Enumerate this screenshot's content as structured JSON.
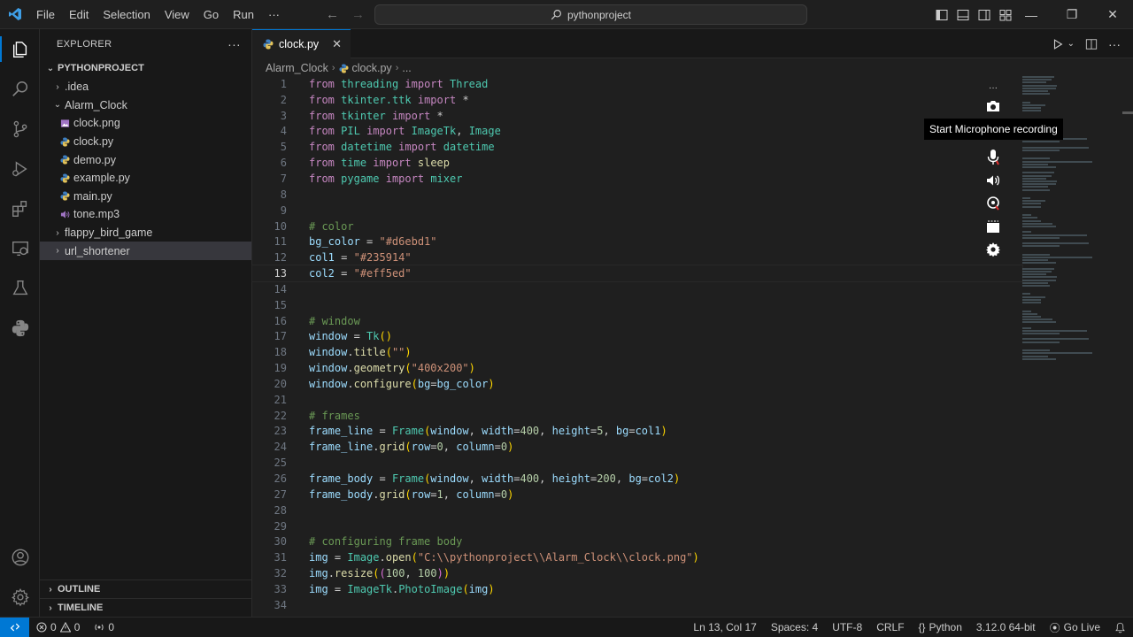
{
  "menu": [
    "File",
    "Edit",
    "Selection",
    "View",
    "Go",
    "Run",
    "···"
  ],
  "search": {
    "text": "pythonproject"
  },
  "window_controls": {
    "minimize": "—",
    "restore": "❐",
    "close": "✕"
  },
  "explorer": {
    "title": "EXPLORER",
    "more": "···",
    "project": "PYTHONPROJECT",
    "items": [
      {
        "label": ".idea",
        "type": "folder-collapsed",
        "depth": 1
      },
      {
        "label": "Alarm_Clock",
        "type": "folder-expanded",
        "depth": 1
      },
      {
        "label": "clock.png",
        "type": "image",
        "depth": 2
      },
      {
        "label": "clock.py",
        "type": "python",
        "depth": 2
      },
      {
        "label": "demo.py",
        "type": "python",
        "depth": 2
      },
      {
        "label": "example.py",
        "type": "python",
        "depth": 2
      },
      {
        "label": "main.py",
        "type": "python",
        "depth": 2
      },
      {
        "label": "tone.mp3",
        "type": "audio",
        "depth": 2
      },
      {
        "label": "flappy_bird_game",
        "type": "folder-collapsed",
        "depth": 1
      },
      {
        "label": "url_shortener",
        "type": "folder-collapsed",
        "depth": 1,
        "selected": true
      }
    ],
    "outline": "OUTLINE",
    "timeline": "TIMELINE"
  },
  "tab": {
    "label": "clock.py",
    "close": "✕"
  },
  "breadcrumbs": {
    "folder": "Alarm_Clock",
    "file": "clock.py",
    "rest": "..."
  },
  "code": [
    [
      [
        "kw",
        "from"
      ],
      [
        "t",
        " "
      ],
      [
        "mod",
        "threading"
      ],
      [
        "t",
        " "
      ],
      [
        "kw",
        "import"
      ],
      [
        "t",
        " "
      ],
      [
        "mod",
        "Thread"
      ]
    ],
    [
      [
        "kw",
        "from"
      ],
      [
        "t",
        " "
      ],
      [
        "mod",
        "tkinter.ttk"
      ],
      [
        "t",
        " "
      ],
      [
        "kw",
        "import"
      ],
      [
        "t",
        " *"
      ]
    ],
    [
      [
        "kw",
        "from"
      ],
      [
        "t",
        " "
      ],
      [
        "mod",
        "tkinter"
      ],
      [
        "t",
        " "
      ],
      [
        "kw",
        "import"
      ],
      [
        "t",
        " *"
      ]
    ],
    [
      [
        "kw",
        "from"
      ],
      [
        "t",
        " "
      ],
      [
        "mod",
        "PIL"
      ],
      [
        "t",
        " "
      ],
      [
        "kw",
        "import"
      ],
      [
        "t",
        " "
      ],
      [
        "mod",
        "ImageTk"
      ],
      [
        "t",
        ", "
      ],
      [
        "mod",
        "Image"
      ]
    ],
    [
      [
        "kw",
        "from"
      ],
      [
        "t",
        " "
      ],
      [
        "mod",
        "datetime"
      ],
      [
        "t",
        " "
      ],
      [
        "kw",
        "import"
      ],
      [
        "t",
        " "
      ],
      [
        "mod",
        "datetime"
      ]
    ],
    [
      [
        "kw",
        "from"
      ],
      [
        "t",
        " "
      ],
      [
        "mod",
        "time"
      ],
      [
        "t",
        " "
      ],
      [
        "kw",
        "import"
      ],
      [
        "t",
        " "
      ],
      [
        "fn",
        "sleep"
      ]
    ],
    [
      [
        "kw",
        "from"
      ],
      [
        "t",
        " "
      ],
      [
        "mod",
        "pygame"
      ],
      [
        "t",
        " "
      ],
      [
        "kw",
        "import"
      ],
      [
        "t",
        " "
      ],
      [
        "mod",
        "mixer"
      ]
    ],
    [],
    [],
    [
      [
        "cmt",
        "# color"
      ]
    ],
    [
      [
        "var",
        "bg_color"
      ],
      [
        "t",
        " = "
      ],
      [
        "str",
        "\"#d6ebd1\""
      ]
    ],
    [
      [
        "var",
        "col1"
      ],
      [
        "t",
        " = "
      ],
      [
        "str",
        "\"#235914\""
      ]
    ],
    [
      [
        "var",
        "col2"
      ],
      [
        "t",
        " = "
      ],
      [
        "str",
        "\"#eff5ed\""
      ]
    ],
    [],
    [],
    [
      [
        "cmt",
        "# window"
      ]
    ],
    [
      [
        "var",
        "window"
      ],
      [
        "t",
        " = "
      ],
      [
        "mod",
        "Tk"
      ],
      [
        "brk",
        "()"
      ]
    ],
    [
      [
        "var",
        "window"
      ],
      [
        "t",
        "."
      ],
      [
        "fn",
        "title"
      ],
      [
        "brk",
        "("
      ],
      [
        "str",
        "\"\""
      ],
      [
        "brk",
        ")"
      ]
    ],
    [
      [
        "var",
        "window"
      ],
      [
        "t",
        "."
      ],
      [
        "fn",
        "geometry"
      ],
      [
        "brk",
        "("
      ],
      [
        "str",
        "\"400x200\""
      ],
      [
        "brk",
        ")"
      ]
    ],
    [
      [
        "var",
        "window"
      ],
      [
        "t",
        "."
      ],
      [
        "fn",
        "configure"
      ],
      [
        "brk",
        "("
      ],
      [
        "var",
        "bg"
      ],
      [
        "t",
        "="
      ],
      [
        "var",
        "bg_color"
      ],
      [
        "brk",
        ")"
      ]
    ],
    [],
    [
      [
        "cmt",
        "# frames"
      ]
    ],
    [
      [
        "var",
        "frame_line"
      ],
      [
        "t",
        " = "
      ],
      [
        "mod",
        "Frame"
      ],
      [
        "brk",
        "("
      ],
      [
        "var",
        "window"
      ],
      [
        "t",
        ", "
      ],
      [
        "var",
        "width"
      ],
      [
        "t",
        "="
      ],
      [
        "num",
        "400"
      ],
      [
        "t",
        ", "
      ],
      [
        "var",
        "height"
      ],
      [
        "t",
        "="
      ],
      [
        "num",
        "5"
      ],
      [
        "t",
        ", "
      ],
      [
        "var",
        "bg"
      ],
      [
        "t",
        "="
      ],
      [
        "var",
        "col1"
      ],
      [
        "brk",
        ")"
      ]
    ],
    [
      [
        "var",
        "frame_line"
      ],
      [
        "t",
        "."
      ],
      [
        "fn",
        "grid"
      ],
      [
        "brk",
        "("
      ],
      [
        "var",
        "row"
      ],
      [
        "t",
        "="
      ],
      [
        "num",
        "0"
      ],
      [
        "t",
        ", "
      ],
      [
        "var",
        "column"
      ],
      [
        "t",
        "="
      ],
      [
        "num",
        "0"
      ],
      [
        "brk",
        ")"
      ]
    ],
    [],
    [
      [
        "var",
        "frame_body"
      ],
      [
        "t",
        " = "
      ],
      [
        "mod",
        "Frame"
      ],
      [
        "brk",
        "("
      ],
      [
        "var",
        "window"
      ],
      [
        "t",
        ", "
      ],
      [
        "var",
        "width"
      ],
      [
        "t",
        "="
      ],
      [
        "num",
        "400"
      ],
      [
        "t",
        ", "
      ],
      [
        "var",
        "height"
      ],
      [
        "t",
        "="
      ],
      [
        "num",
        "200"
      ],
      [
        "t",
        ", "
      ],
      [
        "var",
        "bg"
      ],
      [
        "t",
        "="
      ],
      [
        "var",
        "col2"
      ],
      [
        "brk",
        ")"
      ]
    ],
    [
      [
        "var",
        "frame_body"
      ],
      [
        "t",
        "."
      ],
      [
        "fn",
        "grid"
      ],
      [
        "brk",
        "("
      ],
      [
        "var",
        "row"
      ],
      [
        "t",
        "="
      ],
      [
        "num",
        "1"
      ],
      [
        "t",
        ", "
      ],
      [
        "var",
        "column"
      ],
      [
        "t",
        "="
      ],
      [
        "num",
        "0"
      ],
      [
        "brk",
        ")"
      ]
    ],
    [],
    [],
    [
      [
        "cmt",
        "# configuring frame body"
      ]
    ],
    [
      [
        "var",
        "img"
      ],
      [
        "t",
        " = "
      ],
      [
        "mod",
        "Image"
      ],
      [
        "t",
        "."
      ],
      [
        "fn",
        "open"
      ],
      [
        "brk",
        "("
      ],
      [
        "str",
        "\"C:\\\\pythonproject\\\\Alarm_Clock\\\\clock.png\""
      ],
      [
        "brk",
        ")"
      ]
    ],
    [
      [
        "var",
        "img"
      ],
      [
        "t",
        "."
      ],
      [
        "fn",
        "resize"
      ],
      [
        "brk",
        "("
      ],
      [
        "brk2",
        "("
      ],
      [
        "num",
        "100"
      ],
      [
        "t",
        ", "
      ],
      [
        "num",
        "100"
      ],
      [
        "brk2",
        ")"
      ],
      [
        "brk",
        ")"
      ]
    ],
    [
      [
        "var",
        "img"
      ],
      [
        "t",
        " = "
      ],
      [
        "mod",
        "ImageTk"
      ],
      [
        "t",
        "."
      ],
      [
        "mod",
        "PhotoImage"
      ],
      [
        "brk",
        "("
      ],
      [
        "var",
        "img"
      ],
      [
        "brk",
        ")"
      ]
    ],
    []
  ],
  "current_line": 13,
  "recorder": {
    "tooltip": "Start Microphone recording",
    "more": "···"
  },
  "status": {
    "errors": "0",
    "warnings": "0",
    "ports": "0",
    "position": "Ln 13, Col 17",
    "spaces": "Spaces: 4",
    "encoding": "UTF-8",
    "eol": "CRLF",
    "language": "Python",
    "interpreter": "3.12.0 64-bit",
    "golive": "Go Live"
  }
}
